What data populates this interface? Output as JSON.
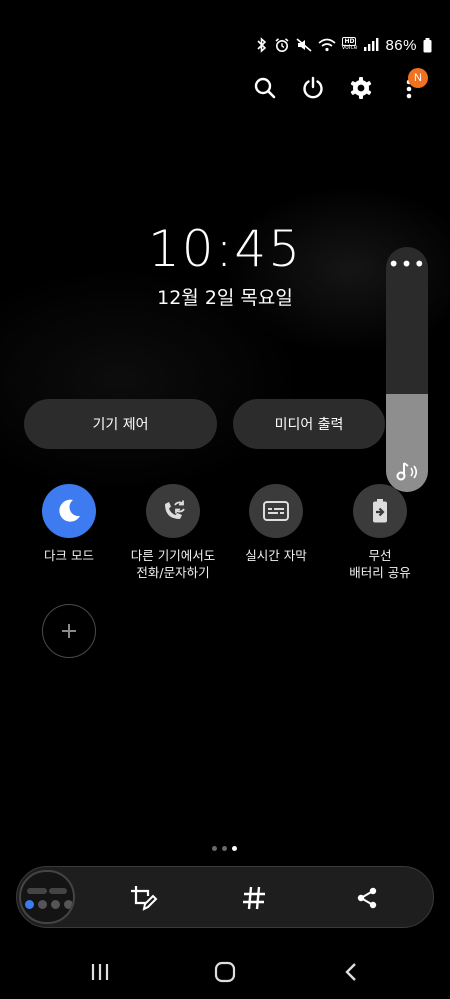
{
  "status_bar": {
    "battery_text": "86%",
    "hd_label": "HD",
    "voice_label": "Voice"
  },
  "notification_badge": "N",
  "lock": {
    "time": "10:45",
    "date": "12월 2일 목요일"
  },
  "volume": {
    "level": 0.4
  },
  "pills": {
    "device_control": "기기 제어",
    "media_output": "미디어 출력"
  },
  "tiles": [
    {
      "line1": "다크 모드",
      "line2": "",
      "icon": "moon-icon",
      "active": true
    },
    {
      "line1": "다른 기기에서도",
      "line2": "전화/문자하기",
      "icon": "call-sync-icon",
      "active": false
    },
    {
      "line1": "실시간 자막",
      "line2": "",
      "icon": "caption-icon",
      "active": false
    },
    {
      "line1": "무선",
      "line2": "배터리 공유",
      "icon": "battery-share-icon",
      "active": false
    }
  ],
  "page_indicator": {
    "count": 3,
    "current": 2
  },
  "colors": {
    "accent": "#3e7bf0",
    "badge": "#f0711f",
    "tile_bg": "#3b3b3b",
    "pill_bg": "#2c2c2c"
  }
}
